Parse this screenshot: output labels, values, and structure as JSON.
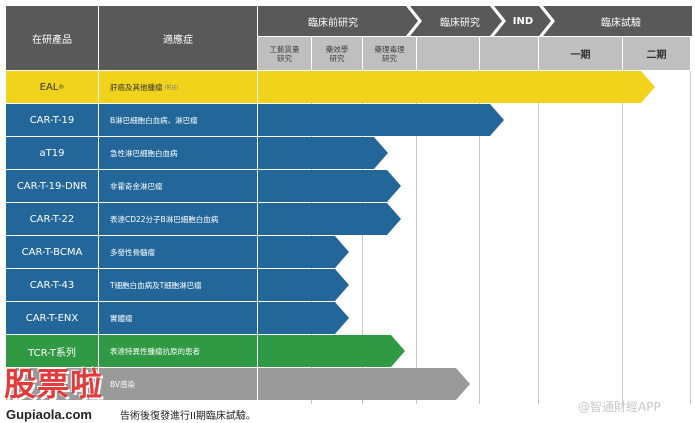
{
  "header": {
    "col_product": "在研產品",
    "col_indication": "適應症",
    "preclinical": "臨床前研究",
    "clinical_research": "臨床研究",
    "ind": "IND",
    "clinical_trials": "臨床試驗",
    "sub_preclinical": [
      "工藝質量\n研究",
      "藥效學\n研究",
      "藥理毒理\n研究"
    ],
    "phase1": "一期",
    "phase2": "二期"
  },
  "rows": [
    {
      "product": "EAL",
      "product_sup": "®",
      "indication": "肝癌及其他腫瘤",
      "indication_note": "(附註)",
      "color": "#f2d31c",
      "text_color": "#333333",
      "progress": 0.92
    },
    {
      "product": "CAR-T-19",
      "indication": "B淋巴細胞白血病、淋巴瘤",
      "color": "#23679a",
      "progress": 0.57
    },
    {
      "product": "aT19",
      "indication": "急性淋巴細胞白血病",
      "color": "#23679a",
      "progress": 0.3
    },
    {
      "product": "CAR-T-19-DNR",
      "indication": "非霍奇金淋巴瘤",
      "color": "#23679a",
      "progress": 0.33
    },
    {
      "product": "CAR-T-22",
      "indication": "表達CD22分子B淋巴細胞白血病",
      "color": "#23679a",
      "progress": 0.33
    },
    {
      "product": "CAR-T-BCMA",
      "indication": "多發性骨髓瘤",
      "color": "#23679a",
      "progress": 0.21
    },
    {
      "product": "CAR-T-43",
      "indication": "T細胞白血病及T細胞淋巴瘤",
      "color": "#23679a",
      "progress": 0.21
    },
    {
      "product": "CAR-T-ENX",
      "indication": "實體瘤",
      "color": "#23679a",
      "progress": 0.21
    },
    {
      "product": "TCR-T系列",
      "indication": "表達特異性腫瘤抗原的患者",
      "color": "#2f9a43",
      "progress": 0.34
    },
    {
      "product": "",
      "indication": "BV感染",
      "color": "#9a9a9a",
      "progress": 0.49
    }
  ],
  "footnote": "告術後復發進行II期臨床試驗。",
  "watermark": {
    "logo": "股票啦",
    "site": "Gupiaola.com",
    "app": "@智通財經APP"
  },
  "colors": {
    "header": "#595959",
    "subheader": "#bfbfbf",
    "yellow": "#f2d31c",
    "blue": "#23679a",
    "green": "#2f9a43",
    "gray": "#9a9a9a"
  }
}
